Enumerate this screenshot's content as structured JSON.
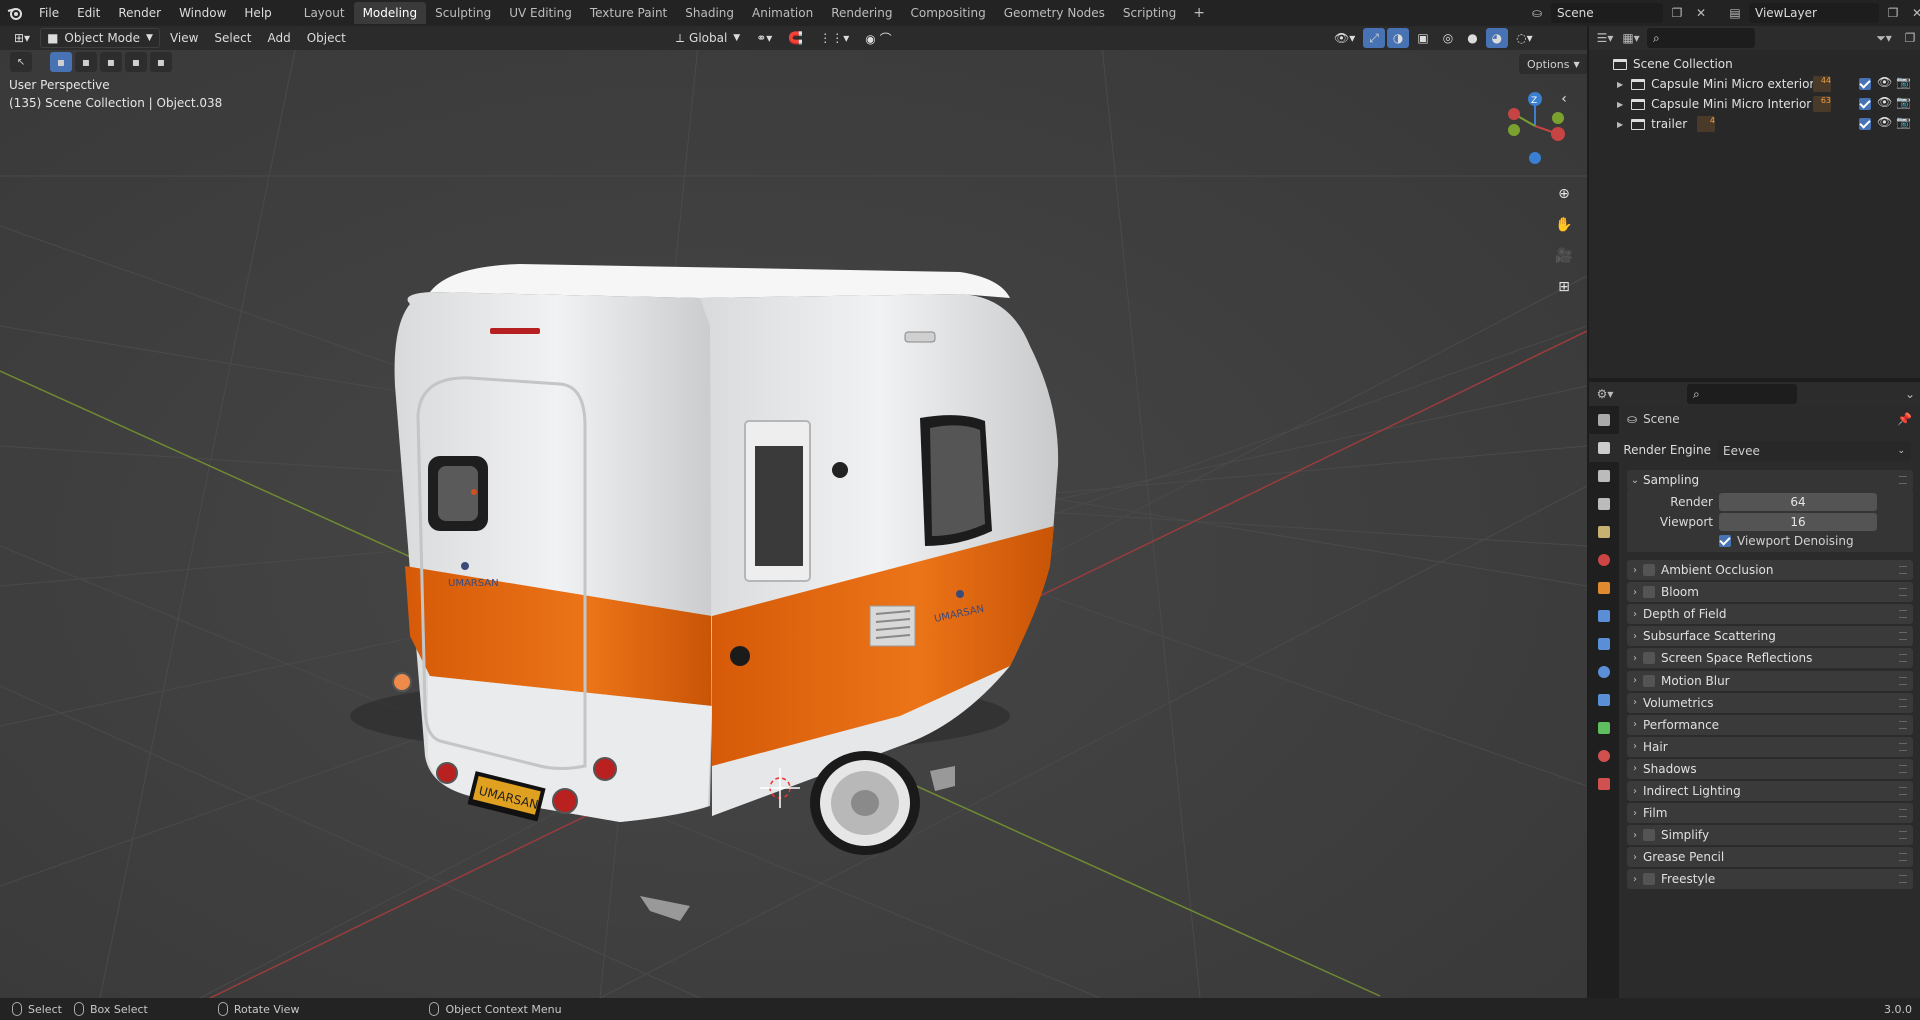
{
  "topbar": {
    "menu": [
      "File",
      "Edit",
      "Render",
      "Window",
      "Help"
    ],
    "workspaces": [
      "Layout",
      "Modeling",
      "Sculpting",
      "UV Editing",
      "Texture Paint",
      "Shading",
      "Animation",
      "Rendering",
      "Compositing",
      "Geometry Nodes",
      "Scripting"
    ],
    "active_workspace": "Modeling",
    "add_tab": "+",
    "scene": "Scene",
    "view_layer": "ViewLayer"
  },
  "viewport": {
    "mode": "Object Mode",
    "menus": [
      "View",
      "Select",
      "Add",
      "Object"
    ],
    "orientation": "Global",
    "options": "Options",
    "info_line1": "User Perspective",
    "info_line2": "(135) Scene Collection | Object.038",
    "gizmo_z": "Z",
    "plate_text": "UMARSAN",
    "logo_text": "UMARSAN"
  },
  "outliner": {
    "root": "Scene Collection",
    "items": [
      {
        "label": "Capsule Mini Micro  exterior",
        "badge": "44"
      },
      {
        "label": "Capsule Mini Micro  Interior",
        "badge": "63"
      },
      {
        "label": "trailer",
        "badge": "4"
      }
    ]
  },
  "properties": {
    "context": "Scene",
    "render_engine_label": "Render Engine",
    "render_engine": "Eevee",
    "sampling": "Sampling",
    "render_label": "Render",
    "render_value": "64",
    "viewport_label": "Viewport",
    "viewport_value": "16",
    "viewport_denoising": "Viewport Denoising",
    "panels": [
      {
        "label": "Ambient Occlusion",
        "checkbox": true
      },
      {
        "label": "Bloom",
        "checkbox": true
      },
      {
        "label": "Depth of Field",
        "checkbox": false
      },
      {
        "label": "Subsurface Scattering",
        "checkbox": false
      },
      {
        "label": "Screen Space Reflections",
        "checkbox": true
      },
      {
        "label": "Motion Blur",
        "checkbox": true
      },
      {
        "label": "Volumetrics",
        "checkbox": false
      },
      {
        "label": "Performance",
        "checkbox": false
      },
      {
        "label": "Hair",
        "checkbox": false
      },
      {
        "label": "Shadows",
        "checkbox": false
      },
      {
        "label": "Indirect Lighting",
        "checkbox": false
      },
      {
        "label": "Film",
        "checkbox": false
      },
      {
        "label": "Simplify",
        "checkbox": true
      },
      {
        "label": "Grease Pencil",
        "checkbox": false
      },
      {
        "label": "Freestyle",
        "checkbox": true
      }
    ]
  },
  "statusbar": {
    "select": "Select",
    "box_select": "Box Select",
    "rotate_view": "Rotate View",
    "context_menu": "Object Context Menu",
    "version": "3.0.0"
  },
  "colors": {
    "accent": "#4772b3",
    "trailer_orange": "#e2670f",
    "trailer_white": "#e8e9ea",
    "x_axis": "#c94a4a",
    "y_axis": "#7fa033"
  }
}
